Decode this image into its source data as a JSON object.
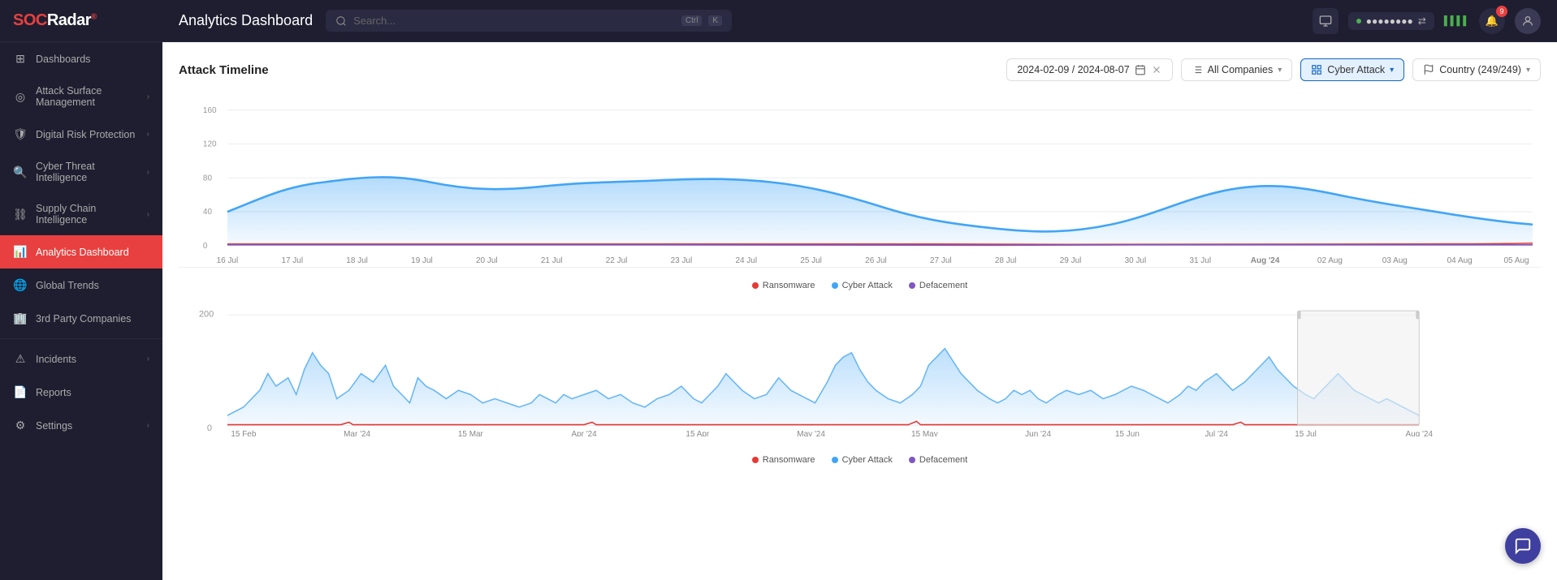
{
  "app": {
    "logo": "SOCRadar",
    "logo_highlight": "SOC"
  },
  "header": {
    "title": "Analytics Dashboard",
    "search_placeholder": "Search...",
    "search_kbd1": "Ctrl",
    "search_kbd2": "K"
  },
  "sidebar": {
    "items": [
      {
        "id": "dashboards",
        "label": "Dashboards",
        "icon": "⊞",
        "has_chevron": false,
        "active": false
      },
      {
        "id": "attack-surface",
        "label": "Attack Surface Management",
        "icon": "◎",
        "has_chevron": true,
        "active": false
      },
      {
        "id": "digital-risk",
        "label": "Digital Risk Protection",
        "icon": "🛡",
        "has_chevron": true,
        "active": false
      },
      {
        "id": "cyber-threat",
        "label": "Cyber Threat Intelligence",
        "icon": "🔍",
        "has_chevron": true,
        "active": false
      },
      {
        "id": "supply-chain",
        "label": "Supply Chain Intelligence",
        "icon": "⛓",
        "has_chevron": true,
        "active": false
      },
      {
        "id": "analytics",
        "label": "Analytics Dashboard",
        "icon": "📊",
        "has_chevron": false,
        "active": true
      },
      {
        "id": "global-trends",
        "label": "Global Trends",
        "icon": "🌐",
        "has_chevron": false,
        "active": false
      },
      {
        "id": "3rd-party",
        "label": "3rd Party Companies",
        "icon": "🏢",
        "has_chevron": false,
        "active": false
      },
      {
        "id": "incidents",
        "label": "Incidents",
        "icon": "⚠",
        "has_chevron": true,
        "active": false
      },
      {
        "id": "reports",
        "label": "Reports",
        "icon": "📄",
        "has_chevron": false,
        "active": false
      },
      {
        "id": "settings",
        "label": "Settings",
        "icon": "⚙",
        "has_chevron": true,
        "active": false
      }
    ]
  },
  "toolbar": {
    "title": "Attack Timeline",
    "date_range": "2024-02-09 / 2024-08-07",
    "filter_companies": "All Companies",
    "filter_type": "Cyber Attack",
    "filter_country": "Country (249/249)"
  },
  "chart1": {
    "y_labels": [
      "160",
      "120",
      "80",
      "40",
      "0"
    ],
    "x_labels": [
      "16 Jul",
      "17 Jul",
      "18 Jul",
      "19 Jul",
      "20 Jul",
      "21 Jul",
      "22 Jul",
      "23 Jul",
      "24 Jul",
      "25 Jul",
      "26 Jul",
      "27 Jul",
      "28 Jul",
      "29 Jul",
      "30 Jul",
      "31 Jul",
      "Aug '24",
      "02 Aug",
      "03 Aug",
      "04 Aug",
      "05 Aug"
    ],
    "legend": [
      {
        "label": "Ransomware",
        "color": "#e53935"
      },
      {
        "label": "Cyber Attack",
        "color": "#42a5f5"
      },
      {
        "label": "Defacement",
        "color": "#7e57c2"
      }
    ]
  },
  "chart2": {
    "y_labels": [
      "200",
      "0"
    ],
    "x_labels": [
      "15 Feb",
      "Mar '24",
      "15 Mar",
      "Apr '24",
      "15 Apr",
      "May '24",
      "15 May",
      "Jun '24",
      "15 Jun",
      "Jul '24",
      "15 Jul",
      "Aug '24"
    ],
    "legend": [
      {
        "label": "Ransomware",
        "color": "#e53935"
      },
      {
        "label": "Cyber Attack",
        "color": "#42a5f5"
      },
      {
        "label": "Defacement",
        "color": "#7e57c2"
      }
    ]
  }
}
